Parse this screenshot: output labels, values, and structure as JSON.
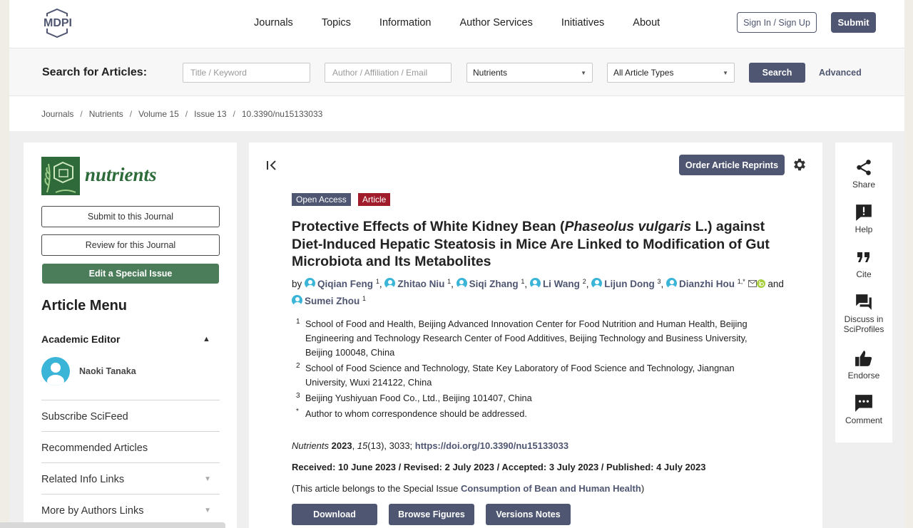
{
  "brand": {
    "logo_text": "MDPI"
  },
  "nav": {
    "items": [
      "Journals",
      "Topics",
      "Information",
      "Author Services",
      "Initiatives",
      "About"
    ]
  },
  "header": {
    "sign_label": "Sign In / Sign Up",
    "submit_label": "Submit"
  },
  "search": {
    "label": "Search for Articles:",
    "title_placeholder": "Title / Keyword",
    "author_placeholder": "Author / Affiliation / Email",
    "journal_value": "Nutrients",
    "type_value": "All Article Types",
    "button": "Search",
    "advanced": "Advanced"
  },
  "breadcrumb": [
    "Journals",
    "Nutrients",
    "Volume 15",
    "Issue 13",
    "10.3390/nu15133033"
  ],
  "sidebar": {
    "journal_name": "nutrients",
    "submit_btn": "Submit to this Journal",
    "review_btn": "Review for this Journal",
    "special_btn": "Edit a Special Issue",
    "menu_title": "Article Menu",
    "academic_editor_label": "Academic Editor",
    "editor_name": "Naoki Tanaka",
    "items": [
      "Subscribe SciFeed",
      "Recommended Articles",
      "Related Info Links",
      "More by Authors Links"
    ]
  },
  "article": {
    "order_btn": "Order Article Reprints",
    "badge_open": "Open Access",
    "badge_type": "Article",
    "title_part1": "Protective Effects of White Kidney Bean (",
    "title_italic": "Phaseolus vulgaris",
    "title_part2": " L.) against Diet-Induced Hepatic Steatosis in Mice Are Linked to Modification of Gut Microbiota and Its Metabolites",
    "by": "by",
    "and": "and",
    "authors": [
      {
        "name": "Qiqian Feng",
        "sup": "1"
      },
      {
        "name": "Zhitao Niu",
        "sup": "1"
      },
      {
        "name": "Siqi Zhang",
        "sup": "1"
      },
      {
        "name": "Li Wang",
        "sup": "2"
      },
      {
        "name": "Lijun Dong",
        "sup": "3"
      },
      {
        "name": "Dianzhi Hou",
        "sup": "1,*"
      },
      {
        "name": "Sumei Zhou",
        "sup": "1"
      }
    ],
    "affiliations": [
      {
        "num": "1",
        "text": "School of Food and Health, Beijing Advanced Innovation Center for Food Nutrition and Human Health, Beijing Engineering and Technology Research Center of Food Additives, Beijing Technology and Business University, Beijing 100048, China"
      },
      {
        "num": "2",
        "text": "School of Food Science and Technology, State Key Laboratory of Food Science and Technology, Jiangnan University, Wuxi 214122, China"
      },
      {
        "num": "3",
        "text": "Beijing Yushiyuan Food Co., Ltd., Beijing 101407, China"
      },
      {
        "num": "*",
        "text": "Author to whom correspondence should be addressed."
      }
    ],
    "citation_journal": "Nutrients",
    "citation_year": "2023",
    "citation_volume": "15",
    "citation_rest": "(13), 3033; ",
    "citation_doi": "https://doi.org/10.3390/nu15133033",
    "dates": "Received: 10 June 2023 / Revised: 2 July 2023 / Accepted: 3 July 2023 / Published: 4 July 2023",
    "special_prefix": "(This article belongs to the Special Issue ",
    "special_link": "Consumption of Bean and Human Health",
    "special_suffix": ")",
    "btn_download": "Download",
    "btn_figures": "Browse Figures",
    "btn_versions": "Versions Notes"
  },
  "rail": {
    "share": "Share",
    "help": "Help",
    "cite": "Cite",
    "discuss_line1": "Discuss in",
    "discuss_line2": "SciProfiles",
    "endorse": "Endorse",
    "comment": "Comment"
  },
  "colors": {
    "primary": "#4f5671",
    "article_badge": "#a01c2b",
    "green": "#4c7d5a",
    "avatar": "#3ab5d8"
  }
}
